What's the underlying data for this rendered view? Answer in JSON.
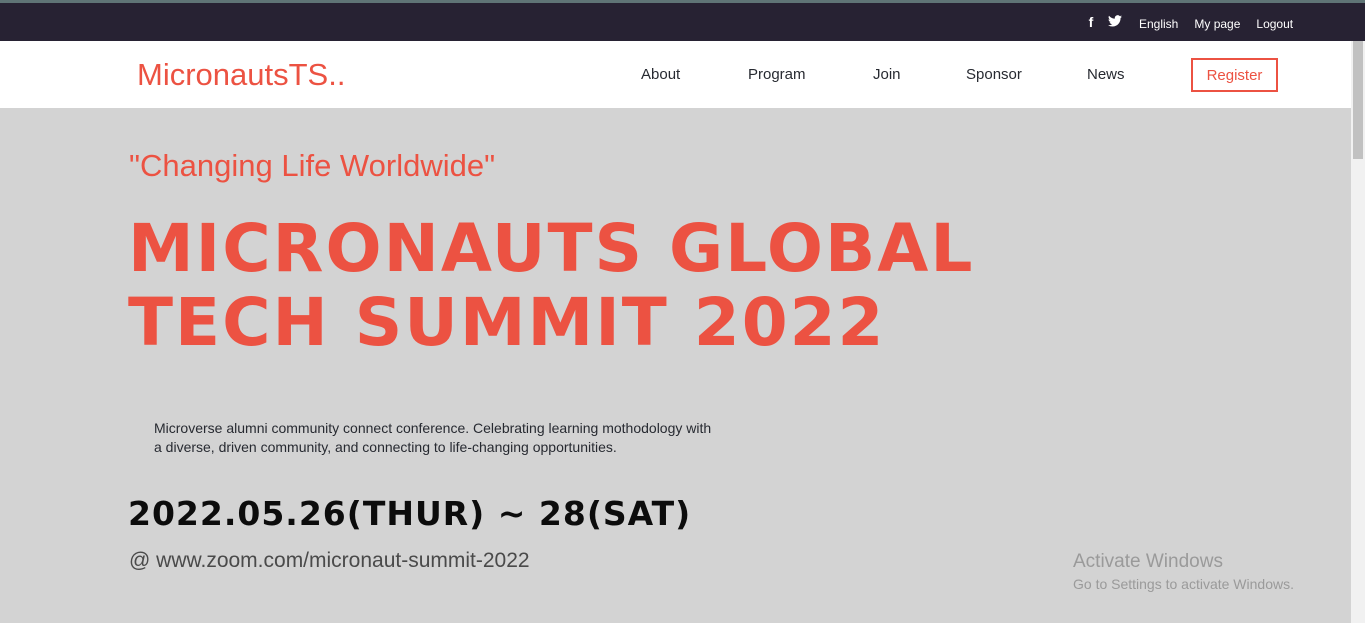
{
  "colors": {
    "accent": "#ec5242",
    "dark": "#272233",
    "hero_bg": "#d3d3d3"
  },
  "topbar": {
    "social_icons": [
      "facebook-icon",
      "twitter-icon"
    ],
    "language": "English",
    "my_page": "My page",
    "logout": "Logout"
  },
  "navbar": {
    "brand": "MicronautsTS..",
    "items": [
      "About",
      "Program",
      "Join",
      "Sponsor",
      "News"
    ],
    "register": "Register"
  },
  "hero": {
    "tagline": "\"Changing Life Worldwide\"",
    "title_line1": "MICRONAUTS GLOBAL",
    "title_line2": "TECH SUMMIT 2022",
    "description": "Microverse alumni community connect conference. Celebrating learning mothodology with a diverse, driven community, and connecting to life-changing opportunities.",
    "date": "2022.05.26(THUR) ~ 28(SAT)",
    "venue": "@ www.zoom.com/micronaut-summit-2022"
  },
  "watermark": {
    "title": "Activate Windows",
    "subtitle": "Go to Settings to activate Windows."
  }
}
